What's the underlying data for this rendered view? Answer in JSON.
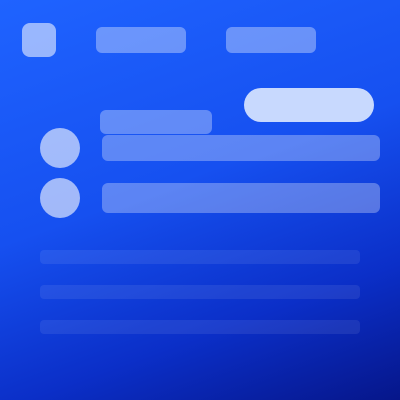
{
  "header": {
    "logo_icon": "app-logo-icon",
    "nav": [
      {
        "label": ""
      },
      {
        "label": ""
      }
    ]
  },
  "action": {
    "label": ""
  },
  "main": {
    "heading": "",
    "rows": [
      {
        "icon": "circle-icon",
        "text": ""
      },
      {
        "icon": "circle-icon",
        "text": ""
      }
    ]
  },
  "colors": {
    "background_top": "#1f63ff",
    "background_bottom": "#06168a",
    "button": "#dce8ff"
  }
}
